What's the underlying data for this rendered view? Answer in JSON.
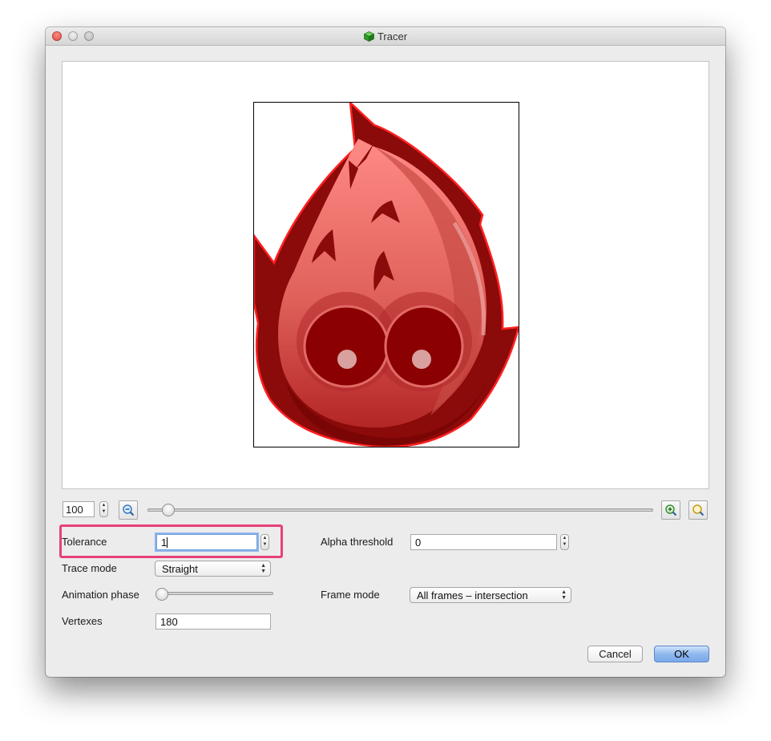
{
  "window": {
    "title": "Tracer"
  },
  "zoom": {
    "value": "100",
    "slider_level": 0.03
  },
  "form": {
    "tolerance": {
      "label": "Tolerance",
      "value": "1"
    },
    "alpha_threshold": {
      "label": "Alpha threshold",
      "value": "0"
    },
    "trace_mode": {
      "label": "Trace mode",
      "value": "Straight"
    },
    "animation_phase": {
      "label": "Animation phase",
      "slider_level": 0.0
    },
    "frame_mode": {
      "label": "Frame mode",
      "value": "All frames – intersection"
    },
    "vertexes": {
      "label": "Vertexes",
      "value": "180"
    }
  },
  "buttons": {
    "cancel": "Cancel",
    "ok": "OK"
  },
  "colors": {
    "highlight": "#e8407a",
    "sprite_dark": "#8b0000",
    "sprite_mid": "#d9534f",
    "sprite_light": "#ff8a85",
    "trace_outline": "#ff2020"
  }
}
